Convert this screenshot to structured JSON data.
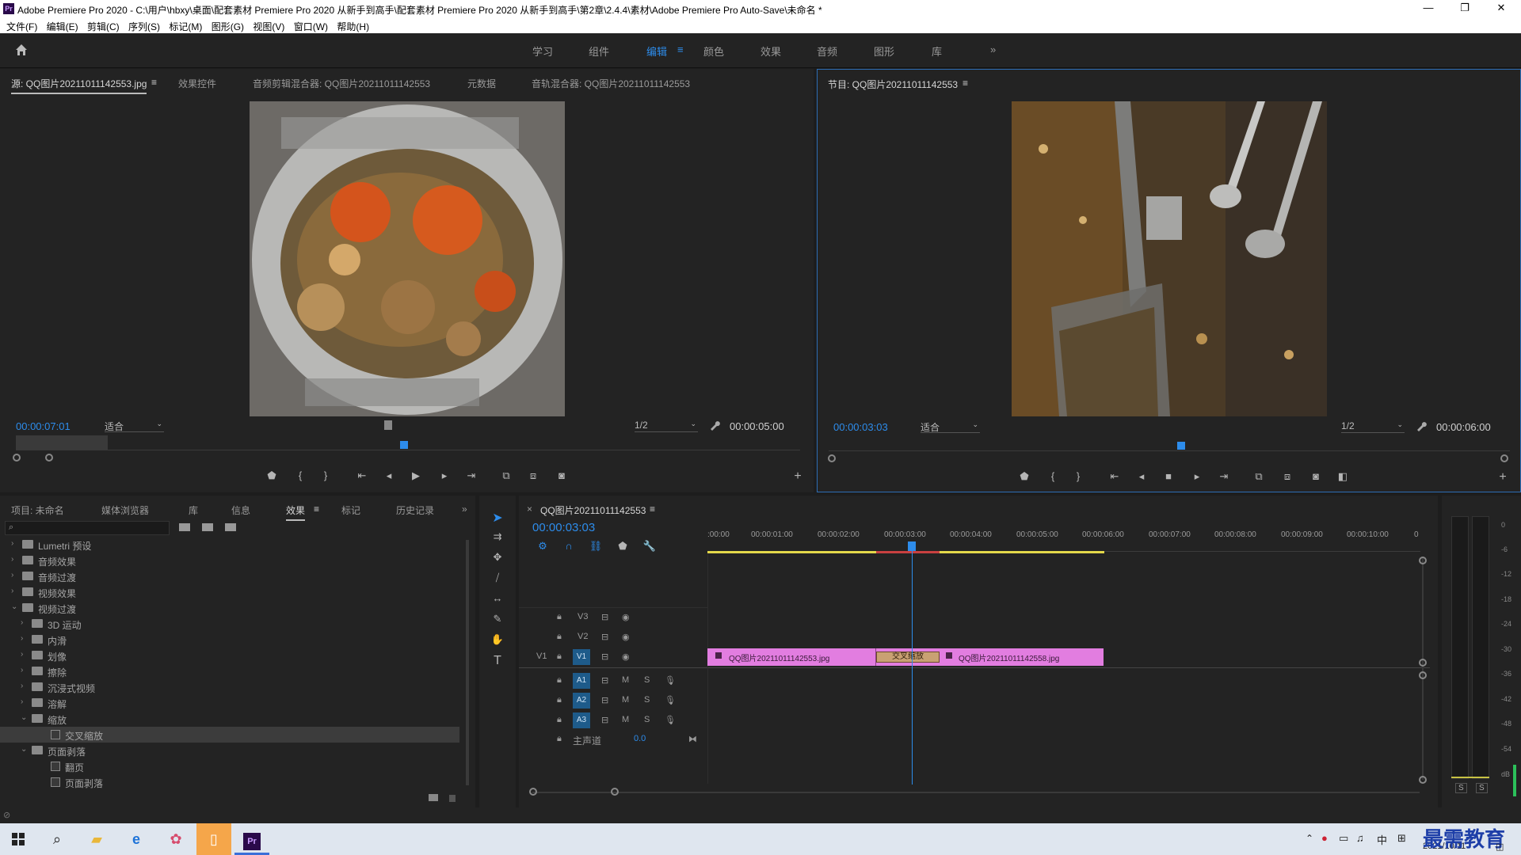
{
  "window": {
    "title": "Adobe Premiere Pro 2020 - C:\\用户\\hbxy\\桌面\\配套素材 Premiere Pro 2020 从新手到高手\\配套素材 Premiere Pro 2020 从新手到高手\\第2章\\2.4.4\\素材\\Adobe Premiere Pro Auto-Save\\未命名 *",
    "app_icon": "Pr",
    "minimize": "—",
    "restore": "❐",
    "close": "✕"
  },
  "menu": [
    "文件(F)",
    "编辑(E)",
    "剪辑(C)",
    "序列(S)",
    "标记(M)",
    "图形(G)",
    "视图(V)",
    "窗口(W)",
    "帮助(H)"
  ],
  "workspaces": {
    "items": [
      "学习",
      "组件",
      "编辑",
      "颜色",
      "效果",
      "音频",
      "图形",
      "库"
    ],
    "active": "编辑",
    "menu_glyph": "≡",
    "more": "»"
  },
  "source": {
    "tabs": [
      "源: QQ图片20211011142553.jpg",
      "效果控件",
      "音频剪辑混合器: QQ图片20211011142553",
      "元数据",
      "音轨混合器: QQ图片20211011142553"
    ],
    "timecode": "00:00:07:01",
    "fit": "适合",
    "resolution": "1/2",
    "duration": "00:00:05:00"
  },
  "program": {
    "tab": "节目: QQ图片20211011142553",
    "timecode": "00:00:03:03",
    "fit": "适合",
    "resolution": "1/2",
    "duration": "00:00:06:00"
  },
  "effects": {
    "tabs": [
      "项目: 未命名",
      "媒体浏览器",
      "库",
      "信息",
      "效果",
      "标记",
      "历史记录"
    ],
    "active_tab": "效果",
    "search_placeholder": "",
    "tree": [
      {
        "label": "Lumetri 预设",
        "level": 0,
        "expanded": false,
        "type": "folder"
      },
      {
        "label": "音频效果",
        "level": 0,
        "expanded": false,
        "type": "folder"
      },
      {
        "label": "音频过渡",
        "level": 0,
        "expanded": false,
        "type": "folder"
      },
      {
        "label": "视频效果",
        "level": 0,
        "expanded": false,
        "type": "folder"
      },
      {
        "label": "视频过渡",
        "level": 0,
        "expanded": true,
        "type": "folder"
      },
      {
        "label": "3D 运动",
        "level": 1,
        "expanded": false,
        "type": "folder"
      },
      {
        "label": "内滑",
        "level": 1,
        "expanded": false,
        "type": "folder"
      },
      {
        "label": "划像",
        "level": 1,
        "expanded": false,
        "type": "folder"
      },
      {
        "label": "擦除",
        "level": 1,
        "expanded": false,
        "type": "folder"
      },
      {
        "label": "沉浸式视频",
        "level": 1,
        "expanded": false,
        "type": "folder"
      },
      {
        "label": "溶解",
        "level": 1,
        "expanded": false,
        "type": "folder"
      },
      {
        "label": "缩放",
        "level": 1,
        "expanded": true,
        "type": "folder"
      },
      {
        "label": "交叉缩放",
        "level": 2,
        "type": "effect",
        "selected": true
      },
      {
        "label": "页面剥落",
        "level": 1,
        "expanded": true,
        "type": "folder"
      },
      {
        "label": "翻页",
        "level": 2,
        "type": "effect"
      },
      {
        "label": "页面剥落",
        "level": 2,
        "type": "effect"
      }
    ]
  },
  "timeline": {
    "tab": "QQ图片20211011142553",
    "timecode": "00:00:03:03",
    "ruler": [
      ":00:00",
      "00:00:01:00",
      "00:00:02:00",
      "00:00:03:00",
      "00:00:04:00",
      "00:00:05:00",
      "00:00:06:00",
      "00:00:07:00",
      "00:00:08:00",
      "00:00:09:00",
      "00:00:10:00",
      "0"
    ],
    "video_tracks": [
      "V3",
      "V2",
      "V1"
    ],
    "audio_tracks": [
      "A1",
      "A2",
      "A3"
    ],
    "source_patch": "V1",
    "master": {
      "label": "主声道",
      "value": "0.0"
    },
    "clip1": "QQ图片20211011142553.jpg",
    "clip2": "QQ图片20211011142558.jpg",
    "transition": "交叉缩放",
    "m": "M",
    "s": "S"
  },
  "meter": {
    "ticks": [
      "0",
      "-6",
      "-12",
      "-18",
      "-24",
      "-30",
      "-36",
      "-42",
      "-48",
      "-54",
      "dB"
    ],
    "solo": "S"
  },
  "taskbar": {
    "ime": "中",
    "date": "2021/10/11",
    "watermark": "最需教育"
  }
}
